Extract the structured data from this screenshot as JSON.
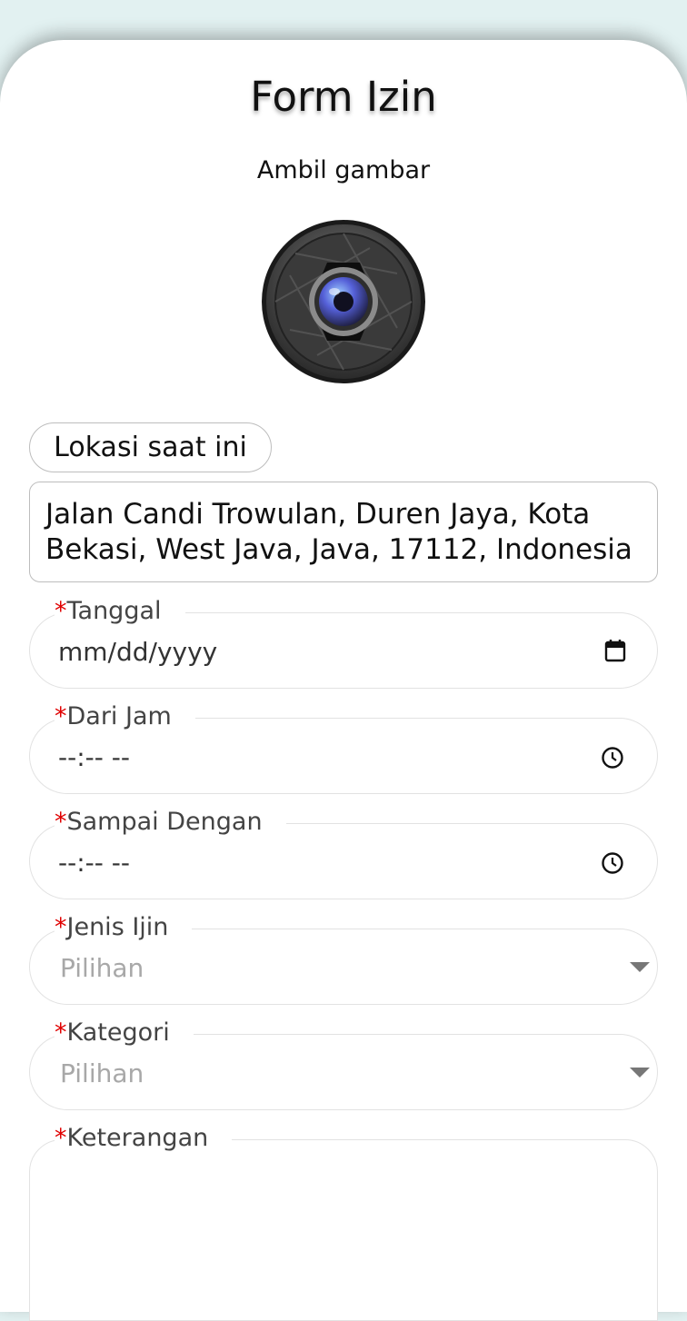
{
  "form": {
    "title": "Form Izin",
    "camera_caption": "Ambil gambar",
    "location_button_label": "Lokasi saat ini",
    "address_value": "Jalan Candi Trowulan, Duren Jaya, Kota Bekasi, West Java, Java, 17112, Indonesia"
  },
  "fields": {
    "tanggal": {
      "required_mark": "*",
      "label": "Tanggal",
      "value": "mm/dd/yyyy",
      "icon": "calendar-icon"
    },
    "dari_jam": {
      "required_mark": "*",
      "label": "Dari Jam",
      "value": "--:-- --",
      "icon": "clock-icon"
    },
    "sampai_dengan": {
      "required_mark": "*",
      "label": "Sampai Dengan",
      "value": "--:-- --",
      "icon": "clock-icon"
    },
    "jenis_ijin": {
      "required_mark": "*",
      "label": "Jenis Ijin",
      "placeholder": "Pilihan",
      "icon": "dropdown-arrow-icon"
    },
    "kategori": {
      "required_mark": "*",
      "label": "Kategori",
      "placeholder": "Pilihan",
      "icon": "dropdown-arrow-icon"
    },
    "keterangan": {
      "required_mark": "*",
      "label": "Keterangan",
      "value": ""
    }
  },
  "colors": {
    "background": "#e2f1f1",
    "required": "#e00000",
    "placeholder": "#a8a8a8"
  }
}
